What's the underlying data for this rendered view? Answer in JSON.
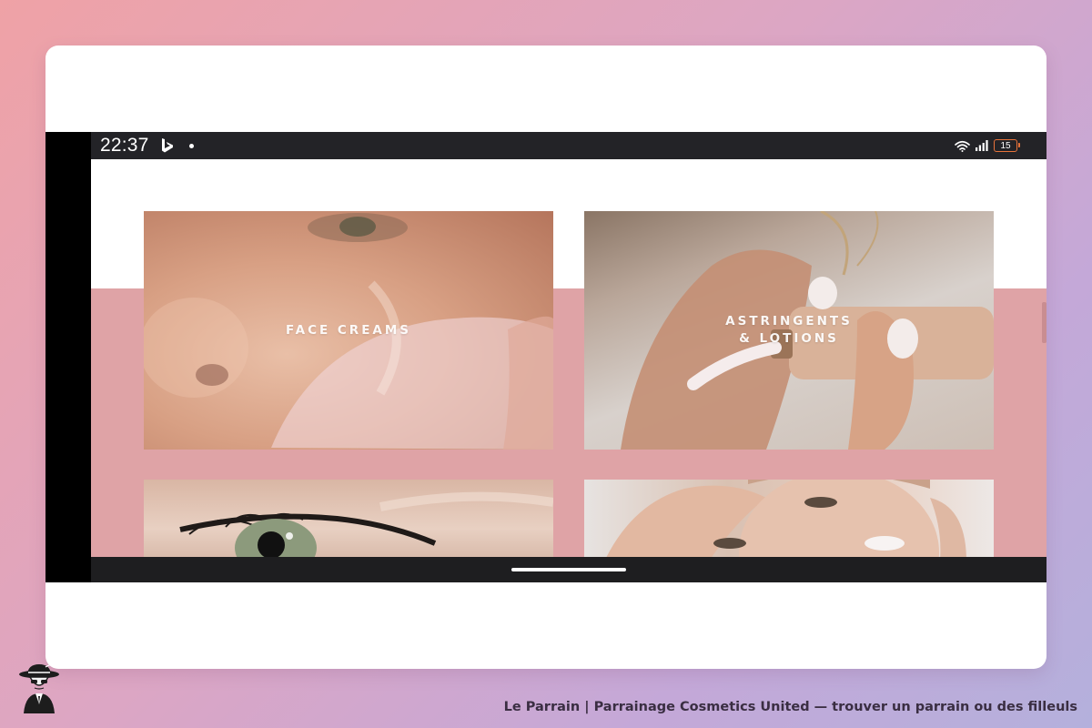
{
  "status_bar": {
    "time": "22:37",
    "battery_level": "15",
    "icons": [
      "bing-icon",
      "dot-icon",
      "wifi-icon",
      "signal-icon",
      "battery-icon"
    ],
    "battery_color": "#e8733a"
  },
  "categories": [
    {
      "label_line1": "FACE CREAMS",
      "label_line2": ""
    },
    {
      "label_line1": "ASTRINGENTS",
      "label_line2": "& LOTIONS"
    }
  ],
  "colors": {
    "accent_pink": "#dfa3a6",
    "status_bar_bg": "#232327",
    "nav_bar_bg": "#1e1e20"
  },
  "footer": {
    "caption": "Le Parrain | Parrainage Cosmetics United — trouver un parrain ou des filleuls",
    "logo_icon": "mascot-icon"
  }
}
